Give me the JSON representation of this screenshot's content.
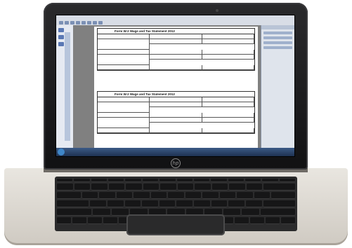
{
  "document": {
    "form_title_1": "Form W-2 Wage and Tax Statement 2012",
    "form_title_2": "Form W-2 Wage and Tax Statement 2012"
  },
  "brand": {
    "logo": "hp"
  },
  "colors": {
    "lid": "#111113",
    "taskbar": "#1e3252",
    "toolbar_accent": "#7b90b5"
  }
}
